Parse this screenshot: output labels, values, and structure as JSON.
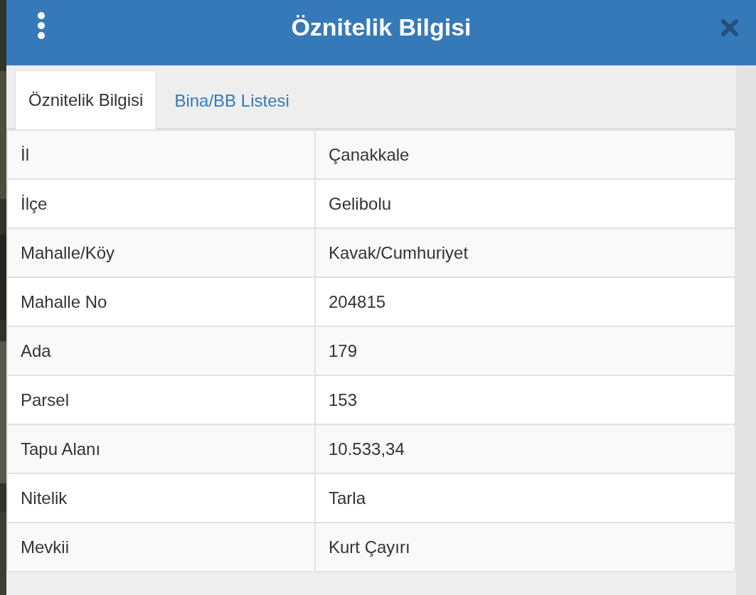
{
  "window": {
    "title": "Öznitelik Bilgisi"
  },
  "tabs": [
    {
      "label": "Öznitelik Bilgisi",
      "selected": true
    },
    {
      "label": "Bina/BB Listesi",
      "selected": false
    }
  ],
  "table": {
    "rows": [
      {
        "label": "İl",
        "value": "Çanakkale"
      },
      {
        "label": "İlçe",
        "value": "Gelibolu"
      },
      {
        "label": "Mahalle/Köy",
        "value": "Kavak/Cumhuriyet"
      },
      {
        "label": "Mahalle No",
        "value": "204815"
      },
      {
        "label": "Ada",
        "value": "179"
      },
      {
        "label": "Parsel",
        "value": "153"
      },
      {
        "label": "Tapu Alanı",
        "value": "10.533,34"
      },
      {
        "label": "Nitelik",
        "value": "Tarla"
      },
      {
        "label": "Mevkii",
        "value": "Kurt Çayırı"
      }
    ]
  }
}
